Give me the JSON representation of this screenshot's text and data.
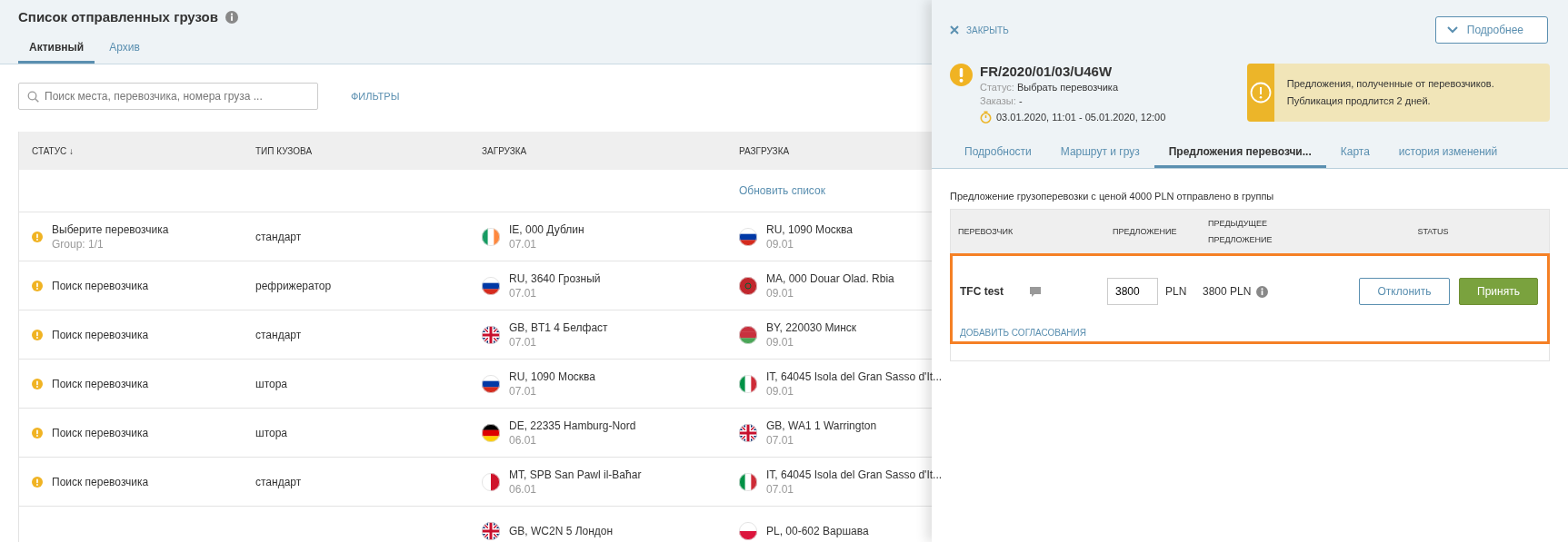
{
  "page": {
    "title": "Список отправленных грузов",
    "tabs": [
      {
        "label": "Активный",
        "selected": true
      },
      {
        "label": "Архив",
        "selected": false
      }
    ]
  },
  "search": {
    "placeholder": "Поиск места, перевозчика, номера груза ..."
  },
  "filters_link": "ФИЛЬТРЫ",
  "table": {
    "columns": [
      "СТАТУС",
      "ТИП КУЗОВА",
      "ЗАГРУЗКА",
      "РАЗГРУЗКА"
    ],
    "sort_mark": "↓",
    "refresh_link": "Обновить список",
    "rows": [
      {
        "status": "Выберите перевозчика",
        "group": "Group: 1/1",
        "body": "стандарт",
        "load": {
          "kind": "ie",
          "place": "IE, 000 Дублин",
          "date": "07.01"
        },
        "unload": {
          "kind": "ru",
          "place": "RU, 1090 Москва",
          "date": "09.01"
        }
      },
      {
        "status": "Поиск перевозчика",
        "body": "рефрижератор",
        "load": {
          "kind": "ru",
          "place": "RU, 3640 Грозный",
          "date": "07.01"
        },
        "unload": {
          "kind": "ma",
          "place": "MA, 000 Douar Olad. Rbia",
          "date": "09.01"
        }
      },
      {
        "status": "Поиск перевозчика",
        "body": "стандарт",
        "load": {
          "kind": "gb",
          "place": "GB, BT1 4 Белфаст",
          "date": "07.01"
        },
        "unload": {
          "kind": "by",
          "place": "BY, 220030 Минск",
          "date": "09.01"
        }
      },
      {
        "status": "Поиск перевозчика",
        "body": "штора",
        "load": {
          "kind": "ru",
          "place": "RU, 1090 Москва",
          "date": "07.01"
        },
        "unload": {
          "kind": "it",
          "place": "IT, 64045 Isola del Gran Sasso d'It...",
          "date": "09.01"
        }
      },
      {
        "status": "Поиск перевозчика",
        "body": "штора",
        "load": {
          "kind": "de",
          "place": "DE, 22335 Hamburg-Nord",
          "date": "06.01"
        },
        "unload": {
          "kind": "gb",
          "place": "GB, WA1 1 Warrington",
          "date": "07.01"
        }
      },
      {
        "status": "Поиск перевозчика",
        "body": "стандарт",
        "load": {
          "kind": "mt",
          "place": "MT, SPB San Pawl il-Baħar",
          "date": "06.01"
        },
        "unload": {
          "kind": "it",
          "place": "IT, 64045 Isola del Gran Sasso d'It...",
          "date": "07.01"
        }
      },
      {
        "load": {
          "kind": "gb",
          "place": "GB, WC2N 5 Лондон"
        },
        "unload": {
          "kind": "pl",
          "place": "PL, 00-602 Варшава"
        }
      }
    ]
  },
  "panel": {
    "close": "ЗАКРЫТЬ",
    "details_button": "Подробнее",
    "shipment_id": "FR/2020/01/03/U46W",
    "status_label": "Статус:",
    "status_value": "Выбрать перевозчика",
    "orders_label": "Заказы:",
    "orders_value": "-",
    "period": "03.01.2020, 11:01 - 05.01.2020, 12:00",
    "notice": "Предложения, полученные от перевозчиков. Публикация продлится 2 дней.",
    "tabs": [
      {
        "label": "Подробности",
        "selected": false
      },
      {
        "label": "Маршрут и груз",
        "selected": false
      },
      {
        "label": "Предложения перевозчи...",
        "selected": true
      },
      {
        "label": "Карта",
        "selected": false
      },
      {
        "label": "история изменений",
        "selected": false
      }
    ],
    "info": "Предложение грузоперевозки с ценой 4000 PLN отправлено в группы",
    "offers": {
      "columns": [
        "ПЕРЕВОЗЧИК",
        "ПРЕДЛОЖЕНИЕ",
        "ПРЕДЫДУЩЕЕ ПРЕДЛОЖЕНИЕ",
        "STATUS"
      ],
      "rows": [
        {
          "carrier": "TFC test",
          "offer": "3800",
          "currency": "PLN",
          "previous": "3800 PLN",
          "reject": "Отклонить",
          "accept": "Принять",
          "add_link": "ДОБАВИТЬ СОГЛАСОВАНИЯ",
          "highlighted": true
        }
      ]
    }
  }
}
